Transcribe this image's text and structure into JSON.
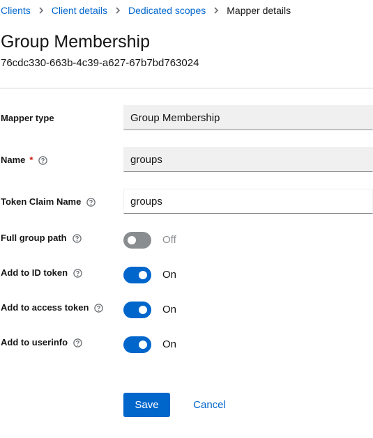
{
  "breadcrumb": {
    "items": [
      "Clients",
      "Client details",
      "Dedicated scopes"
    ],
    "current": "Mapper details"
  },
  "header": {
    "title": "Group Membership",
    "id": "76cdc330-663b-4c39-a627-67b7bd763024"
  },
  "form": {
    "mapper_type": {
      "label": "Mapper type",
      "value": "Group Membership"
    },
    "name": {
      "label": "Name",
      "required_mark": "*",
      "value": "groups"
    },
    "token_claim_name": {
      "label": "Token Claim Name",
      "value": "groups"
    },
    "full_group_path": {
      "label": "Full group path",
      "state": "Off",
      "enabled": false
    },
    "add_to_id_token": {
      "label": "Add to ID token",
      "state": "On",
      "enabled": true
    },
    "add_to_access_token": {
      "label": "Add to access token",
      "state": "On",
      "enabled": true
    },
    "add_to_userinfo": {
      "label": "Add to userinfo",
      "state": "On",
      "enabled": true
    }
  },
  "actions": {
    "save_label": "Save",
    "cancel_label": "Cancel"
  },
  "icons": {
    "breadcrumb_separator": "chevron-right-icon",
    "help": "help-circle-icon"
  },
  "colors": {
    "primary": "#0066cc",
    "required": "#c9190b",
    "switch_off": "#8a8d90"
  }
}
